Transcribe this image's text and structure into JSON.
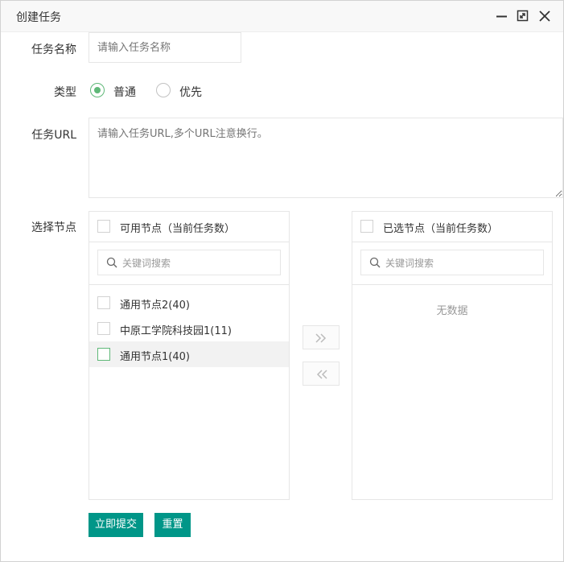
{
  "window": {
    "title": "创建任务"
  },
  "form": {
    "task_name": {
      "label": "任务名称",
      "placeholder": "请输入任务名称"
    },
    "type": {
      "label": "类型",
      "options": [
        "普通",
        "优先"
      ],
      "selected": "普通"
    },
    "task_url": {
      "label": "任务URL",
      "placeholder": "请输入任务URL,多个URL注意换行。"
    },
    "node_select_label": "选择节点"
  },
  "transfer": {
    "left": {
      "title": "可用节点（当前任务数）",
      "search_placeholder": "关键词搜索",
      "items": [
        "通用节点2(40)",
        "中原工学院科技园1(11)",
        "通用节点1(40)"
      ]
    },
    "right": {
      "title": "已选节点（当前任务数）",
      "search_placeholder": "关键词搜索",
      "empty_text": "无数据"
    }
  },
  "actions": {
    "submit": "立即提交",
    "reset": "重置"
  },
  "colors": {
    "primary": "#009688",
    "radio_checked": "#5FB878",
    "border": "#e6e6e6"
  }
}
